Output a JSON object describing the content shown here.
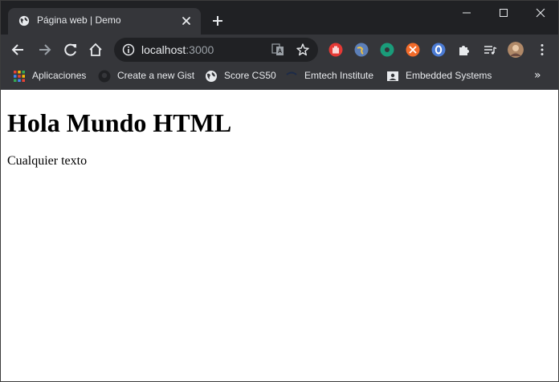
{
  "tab": {
    "title": "Página web | Demo"
  },
  "omnibox": {
    "host": "localhost",
    "port": ":3000"
  },
  "bookmarks": [
    {
      "label": "Aplicaciones",
      "icon": "apps-grid-icon"
    },
    {
      "label": "Create a new Gist",
      "icon": "github-icon"
    },
    {
      "label": "Score CS50",
      "icon": "globe-icon"
    },
    {
      "label": "Emtech Institute",
      "icon": "emtech-icon"
    },
    {
      "label": "Embedded Systems",
      "icon": "portrait-icon"
    }
  ],
  "bookmarks_more": "»",
  "page": {
    "heading": "Hola Mundo HTML",
    "paragraph": "Cualquier texto"
  },
  "colors": {
    "titlebar": "#202124",
    "toolbar": "#35363a",
    "omnibox": "#202124",
    "text_light": "#e8eaed",
    "text_muted": "#9aa0a6",
    "content_bg": "#ffffff"
  }
}
